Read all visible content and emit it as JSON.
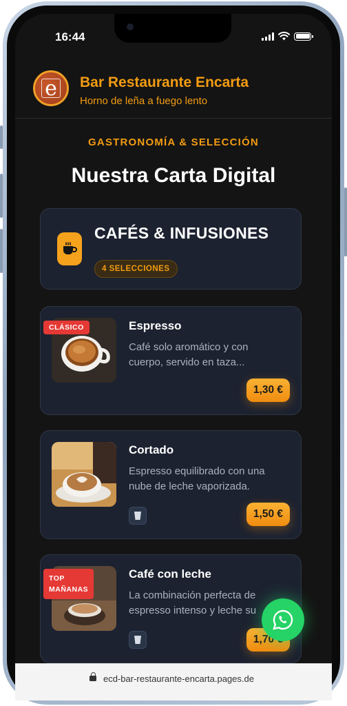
{
  "status_bar": {
    "time": "16:44"
  },
  "header": {
    "logo_letter": "e",
    "title": "Bar Restaurante Encarta",
    "subtitle": "Horno de leña a fuego lento"
  },
  "section": {
    "kicker": "GASTRONOMÍA & SELECCIÓN",
    "title": "Nuestra Carta Digital"
  },
  "category": {
    "title": "CAFÉS & INFUSIONES",
    "count_label": "4 SELECCIONES",
    "icon": "coffee-cup-icon"
  },
  "items": [
    {
      "name": "Espresso",
      "desc_line1": "Café solo aromático y con",
      "desc_line2": "cuerpo, servido en taza...",
      "price": "1,30 €",
      "tag": "CLÁSICO"
    },
    {
      "name": "Cortado",
      "desc_line1": "Espresso equilibrado con una",
      "desc_line2": "nube de leche vaporizada.",
      "price": "1,50 €",
      "icon": "glass-icon"
    },
    {
      "name": "Café con leche",
      "desc_line1": "La combinación perfecta de",
      "desc_line2": "espresso intenso y leche su",
      "price": "1,70 €",
      "tag_line1": "TOP",
      "tag_line2": "MAÑANAS",
      "icon": "glass-icon"
    }
  ],
  "url_bar": {
    "url": "ecd-bar-restaurante-encarta.pages.de"
  },
  "colors": {
    "accent": "#f39c12",
    "background": "#141414",
    "card": "#1c2230",
    "tag_red": "#e53935",
    "whatsapp": "#25d366"
  }
}
